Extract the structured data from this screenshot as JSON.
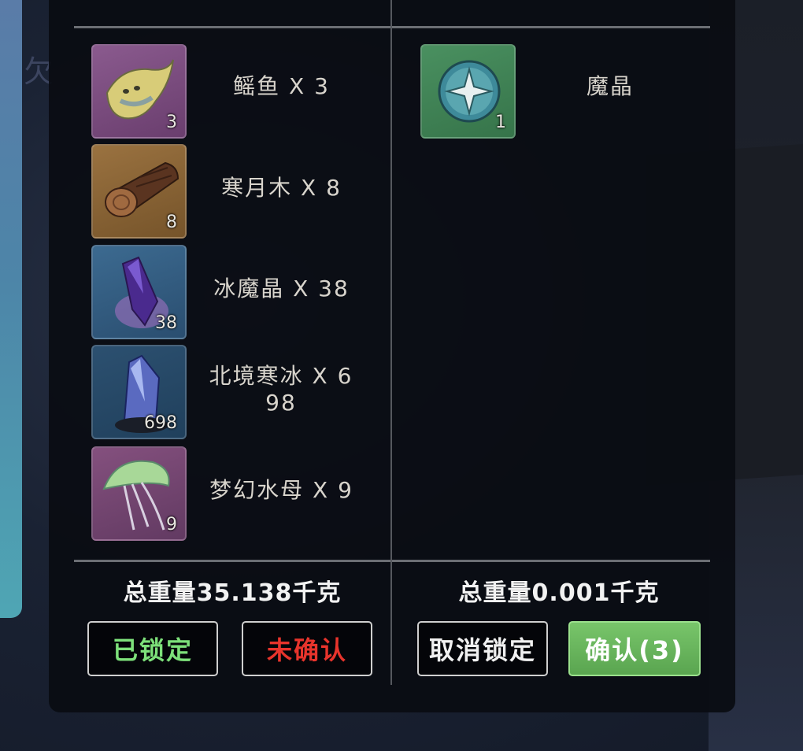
{
  "left_items": [
    {
      "name": "鳐鱼 X 3",
      "qty": "3",
      "icon": "stingray-icon"
    },
    {
      "name": "寒月木 X 8",
      "qty": "8",
      "icon": "log-icon"
    },
    {
      "name": "冰魔晶 X 38",
      "qty": "38",
      "icon": "ice-crystal-icon"
    },
    {
      "name": "北境寒冰 X 6\n98",
      "qty": "698",
      "icon": "north-ice-icon"
    },
    {
      "name": "梦幻水母 X 9",
      "qty": "9",
      "icon": "jellyfish-icon"
    }
  ],
  "right_items": [
    {
      "name": "魔晶",
      "qty": "1",
      "icon": "magic-crystal-icon"
    }
  ],
  "left_weight": "总重量35.138千克",
  "right_weight": "总重量0.001千克",
  "buttons": {
    "locked": "已锁定",
    "unconfirmed": "未确认",
    "cancel_lock": "取消锁定",
    "confirm": "确认(3)"
  },
  "background_char": "欠",
  "colors": {
    "locked_text": "#7de07a",
    "unconfirmed_text": "#e8342c",
    "confirm_bg": "#6ab45e",
    "slot_purple": "#7a4a7e",
    "slot_orange": "#8a6636",
    "slot_blue": "#34587a",
    "slot_green": "#3f7f52"
  }
}
